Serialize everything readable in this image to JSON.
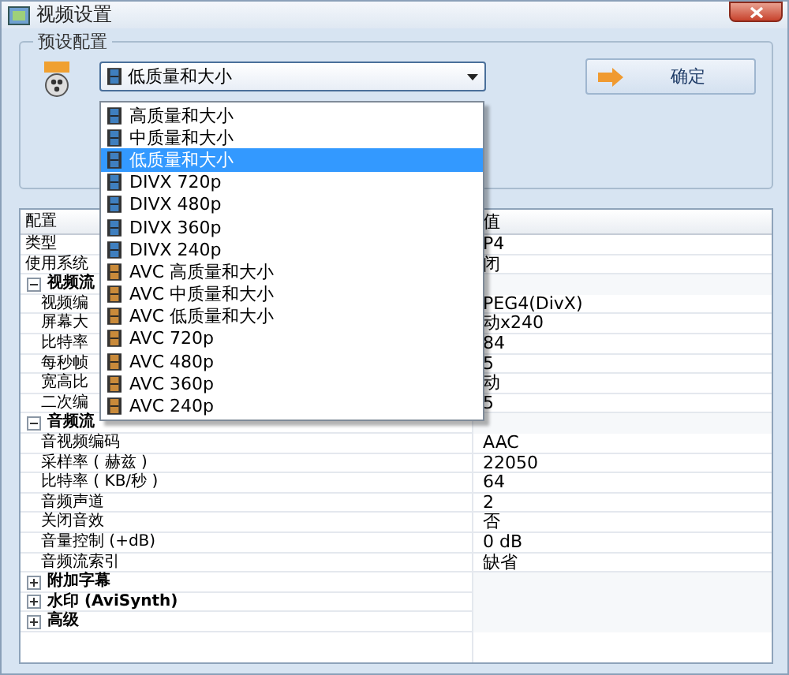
{
  "window": {
    "title": "视频设置"
  },
  "preset_group": {
    "legend": "预设配置",
    "combo_value": "低质量和大小",
    "confirm_button": "确定"
  },
  "dropdown": {
    "items": [
      {
        "kind": "divx",
        "label": "高质量和大小",
        "selected": false
      },
      {
        "kind": "divx",
        "label": "中质量和大小",
        "selected": false
      },
      {
        "kind": "divx",
        "label": "低质量和大小",
        "selected": true
      },
      {
        "kind": "divx",
        "label": "DIVX 720p",
        "selected": false
      },
      {
        "kind": "divx",
        "label": "DIVX 480p",
        "selected": false
      },
      {
        "kind": "divx",
        "label": "DIVX 360p",
        "selected": false
      },
      {
        "kind": "divx",
        "label": "DIVX 240p",
        "selected": false
      },
      {
        "kind": "avc",
        "label": "AVC 高质量和大小",
        "selected": false
      },
      {
        "kind": "avc",
        "label": "AVC 中质量和大小",
        "selected": false
      },
      {
        "kind": "avc",
        "label": "AVC 低质量和大小",
        "selected": false
      },
      {
        "kind": "avc",
        "label": "AVC 720p",
        "selected": false
      },
      {
        "kind": "avc",
        "label": "AVC 480p",
        "selected": false
      },
      {
        "kind": "avc",
        "label": "AVC 360p",
        "selected": false
      },
      {
        "kind": "avc",
        "label": "AVC 240p",
        "selected": false
      }
    ]
  },
  "property_grid": {
    "columns": [
      "配置",
      "值"
    ],
    "rows": [
      {
        "kind": "row",
        "label": "类型",
        "value": "P4"
      },
      {
        "kind": "row",
        "label": "使用系统",
        "value": "闭"
      },
      {
        "kind": "section",
        "label": "视频流",
        "expanded": true,
        "children": [
          {
            "kind": "row",
            "label": "视频编",
            "value": "PEG4(DivX)"
          },
          {
            "kind": "row",
            "label": "屏幕大",
            "value": "动x240"
          },
          {
            "kind": "row",
            "label": "比特率",
            "value": "84"
          },
          {
            "kind": "row",
            "label": "每秒帧",
            "value": "5"
          },
          {
            "kind": "row",
            "label": "宽高比",
            "value": "动"
          },
          {
            "kind": "row",
            "label": "二次编",
            "value": "5"
          }
        ]
      },
      {
        "kind": "section",
        "label": "音频流",
        "expanded": true,
        "children": [
          {
            "kind": "row",
            "label": "音视频编码",
            "value": "AAC"
          },
          {
            "kind": "row",
            "label": "采样率 ( 赫兹 )",
            "value": "22050"
          },
          {
            "kind": "row",
            "label": "比特率 ( KB/秒 )",
            "value": "64"
          },
          {
            "kind": "row",
            "label": "音频声道",
            "value": "2"
          },
          {
            "kind": "row",
            "label": "关闭音效",
            "value": "否"
          },
          {
            "kind": "row",
            "label": "音量控制 (+dB)",
            "value": "0 dB"
          },
          {
            "kind": "row",
            "label": "音频流索引",
            "value": "缺省"
          }
        ]
      },
      {
        "kind": "section",
        "label": "附加字幕",
        "expanded": false,
        "children": []
      },
      {
        "kind": "section",
        "label": "水印 (AviSynth)",
        "expanded": false,
        "children": []
      },
      {
        "kind": "section",
        "label": "高级",
        "expanded": false,
        "children": []
      }
    ]
  }
}
